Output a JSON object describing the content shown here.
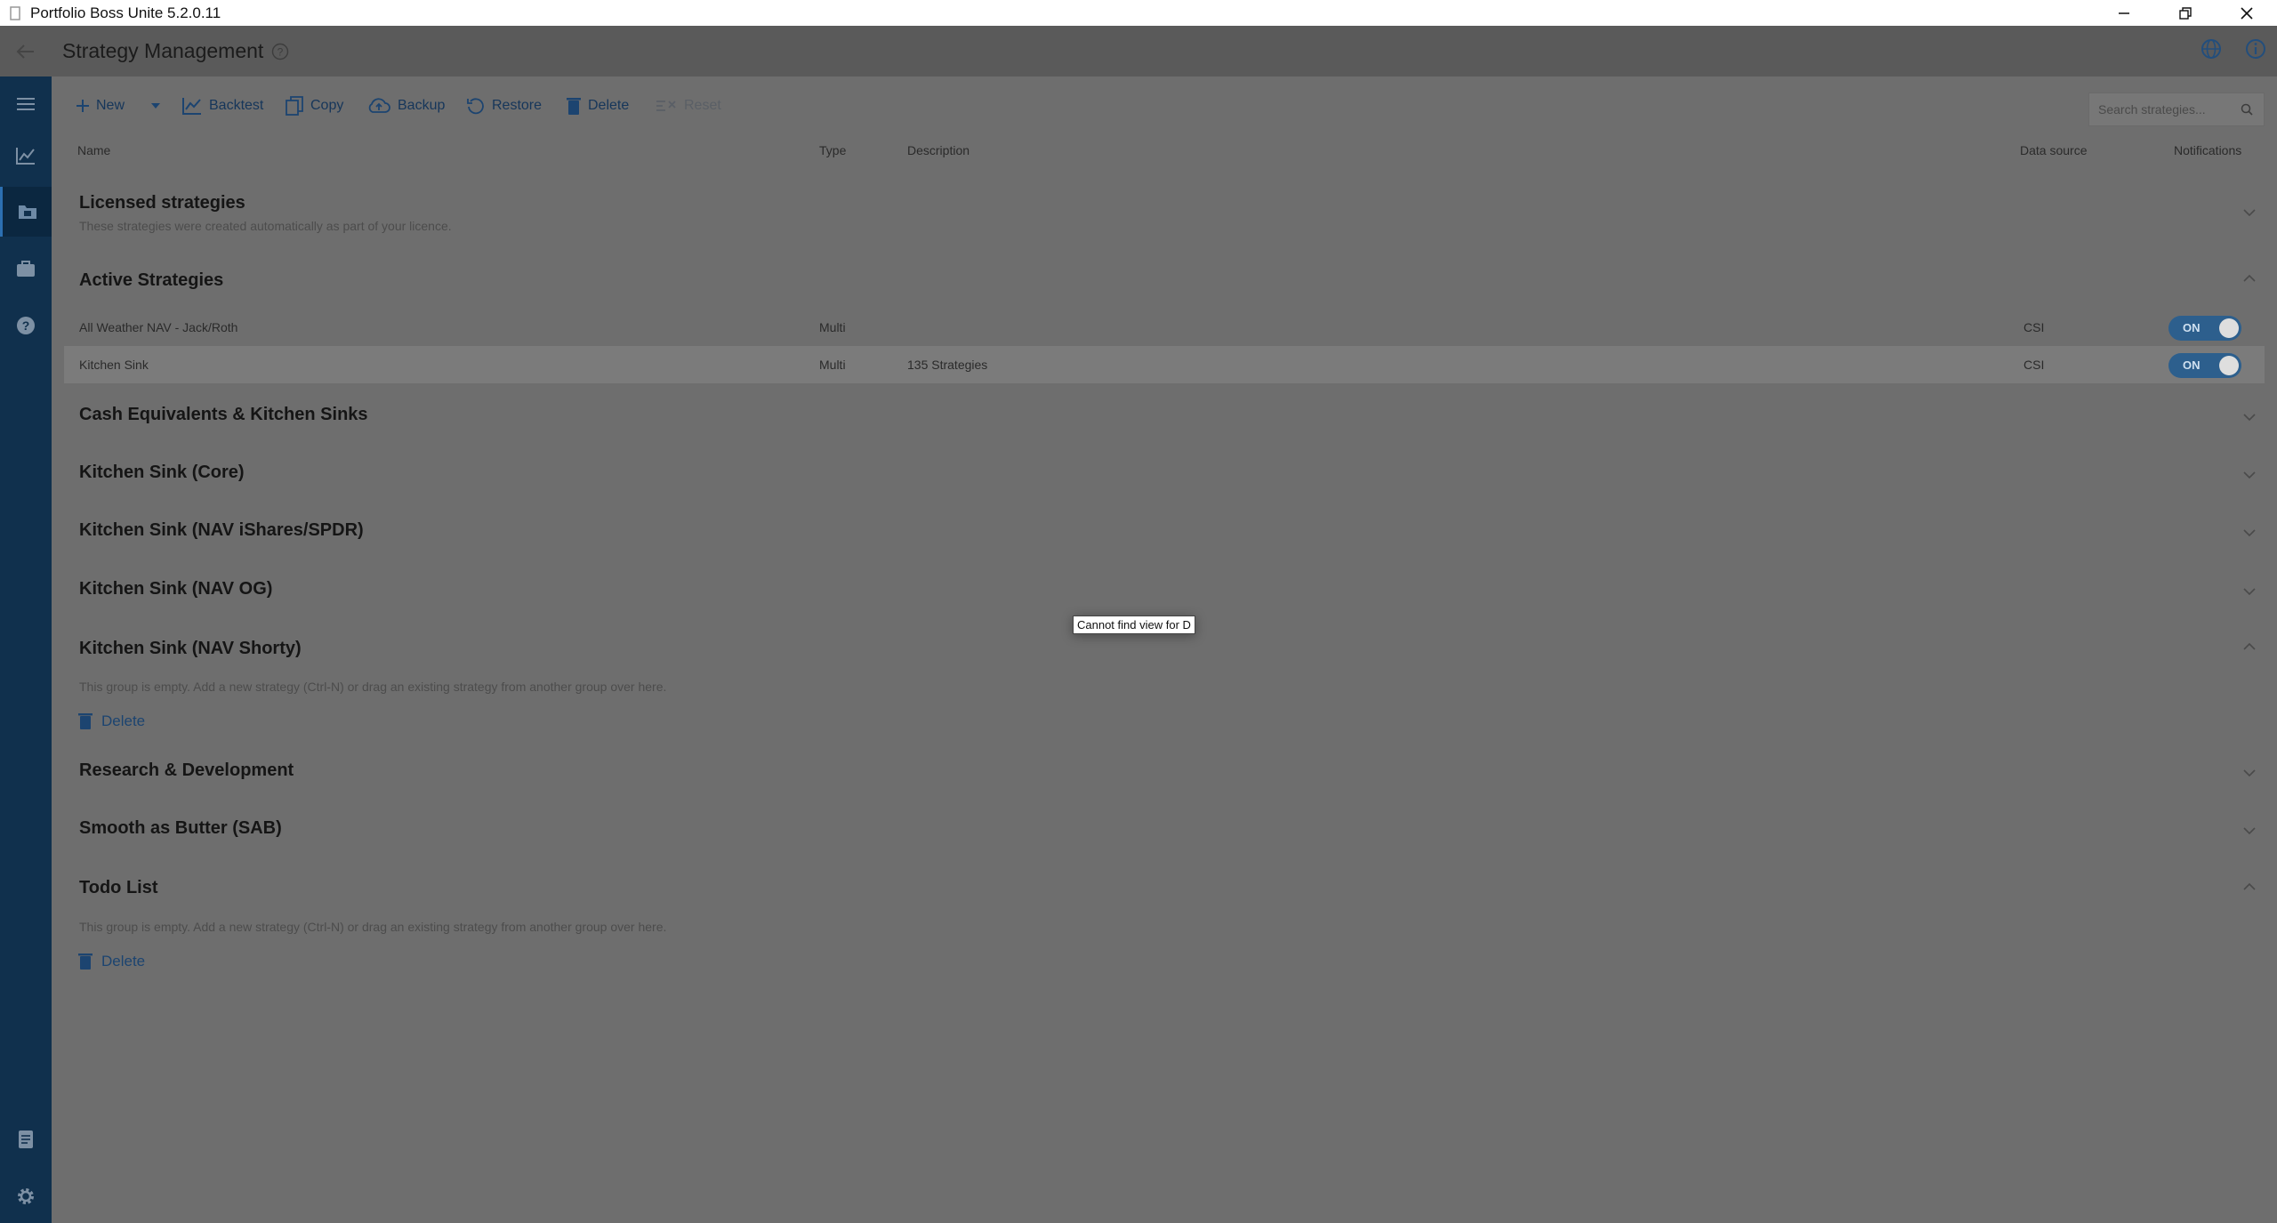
{
  "window": {
    "title": "Portfolio Boss Unite 5.2.0.11"
  },
  "header": {
    "title": "Strategy Management"
  },
  "toolbar": {
    "new_label": "New",
    "backtest_label": "Backtest",
    "copy_label": "Copy",
    "backup_label": "Backup",
    "restore_label": "Restore",
    "delete_label": "Delete",
    "reset_label": "Reset",
    "search_placeholder": "Search strategies..."
  },
  "columns": {
    "name": "Name",
    "type": "Type",
    "description": "Description",
    "data_source": "Data source",
    "notifications": "Notifications"
  },
  "groups": [
    {
      "title": "Licensed strategies",
      "subtitle": "These strategies were created automatically as part of your licence.",
      "expanded": false
    },
    {
      "title": "Active Strategies",
      "expanded": true
    },
    {
      "title": "Cash Equivalents & Kitchen Sinks",
      "expanded": false
    },
    {
      "title": "Kitchen Sink (Core)",
      "expanded": false
    },
    {
      "title": "Kitchen Sink (NAV iShares/SPDR)",
      "expanded": false
    },
    {
      "title": "Kitchen Sink (NAV OG)",
      "expanded": false
    },
    {
      "title": "Kitchen Sink (NAV Shorty)",
      "expanded": true,
      "empty_text": "This group is empty. Add a new strategy (Ctrl-N) or drag an existing strategy from another group over here.",
      "delete_label": "Delete"
    },
    {
      "title": "Research & Development",
      "expanded": false
    },
    {
      "title": "Smooth as Butter (SAB)",
      "expanded": false
    },
    {
      "title": "Todo List",
      "expanded": true,
      "empty_text": "This group is empty. Add a new strategy (Ctrl-N) or drag an existing strategy from another group over here.",
      "delete_label": "Delete"
    }
  ],
  "active_strategies": [
    {
      "name": "All Weather NAV - Jack/Roth",
      "type": "Multi",
      "description": "",
      "data_source": "CSI",
      "notifications": "ON",
      "selected": false
    },
    {
      "name": "Kitchen Sink",
      "type": "Multi",
      "description": "135 Strategies",
      "data_source": "CSI",
      "notifications": "ON",
      "selected": true
    }
  ],
  "tooltip": {
    "text": "Cannot find view for D"
  },
  "colors": {
    "rail": "#10304d",
    "accent": "#2d5f8d",
    "overlay_background": "#6e6e6e"
  },
  "icons": {
    "rail": [
      "menu-icon",
      "chart-icon",
      "folder-icon",
      "briefcase-icon",
      "help-icon",
      "document-icon",
      "settings-icon"
    ],
    "header": [
      "globe-icon",
      "info-icon"
    ]
  }
}
